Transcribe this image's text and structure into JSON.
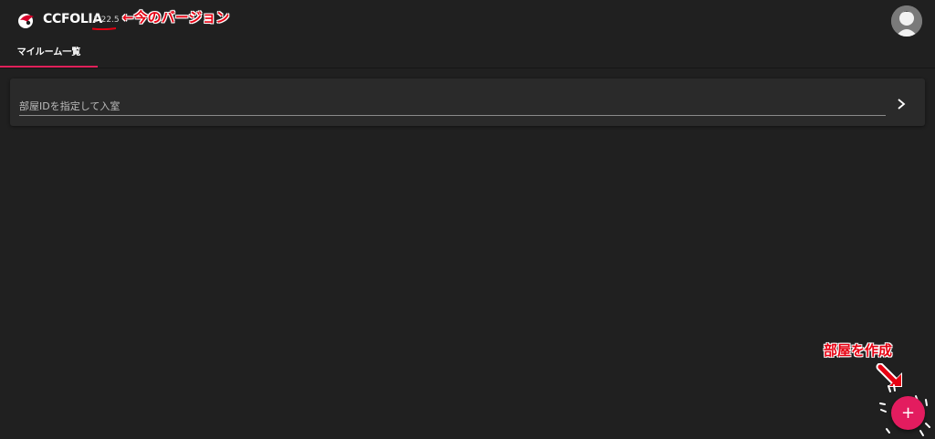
{
  "app": {
    "brand": "CCFOLIA",
    "version": "1.22.5"
  },
  "annotations": {
    "version_note": "←今のバージョン",
    "create_note": "部屋を作成"
  },
  "tabs": [
    {
      "label": "マイルーム一覧",
      "active": true
    }
  ],
  "room_entry": {
    "placeholder": "部屋IDを指定して入室",
    "value": ""
  },
  "fab": {
    "label": "+"
  },
  "colors": {
    "background": "#202020",
    "card": "#2a2a2a",
    "accent": "#e31c5f",
    "annotation": "#e60012"
  }
}
